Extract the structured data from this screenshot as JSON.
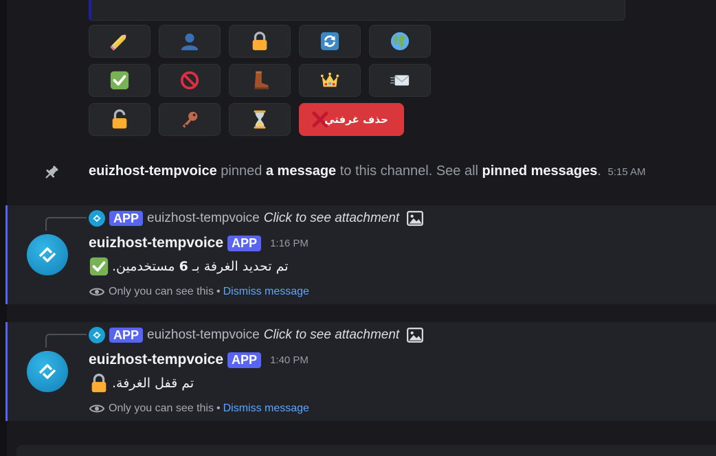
{
  "top_buttons": {
    "delete_room_label": "حذف غرفتي"
  },
  "icons": {
    "row1": [
      "pencil-icon",
      "user-icon",
      "lock-icon",
      "refresh-icon",
      "globe-icon"
    ],
    "row2": [
      "check-icon",
      "block-icon",
      "boot-icon",
      "crown-icon",
      "envelope-icon"
    ],
    "row3": [
      "unlock-icon",
      "key-icon",
      "hourglass-icon",
      "cross-icon"
    ]
  },
  "pin_notice": {
    "user": "euizhost-tempvoice",
    "pinned": " pinned ",
    "a_message": "a message",
    "to_channel": " to this channel. See all ",
    "pinned_messages": "pinned messages",
    "period": ".",
    "time": "5:15 AM"
  },
  "messages": [
    {
      "reply": {
        "badge": "APP",
        "name": "euizhost-tempvoice",
        "text": "Click to see attachment"
      },
      "author": "euizhost-tempvoice",
      "badge": "APP",
      "time": "1:16 PM",
      "text_before": "تم تحديد الغرفة بـ ",
      "text_bold": "6",
      "text_after": " مستخدمين.",
      "emoji": "check-icon",
      "only_you": "Only you can see this",
      "separator": "•",
      "dismiss": "Dismiss message"
    },
    {
      "reply": {
        "badge": "APP",
        "name": "euizhost-tempvoice",
        "text": "Click to see attachment"
      },
      "author": "euizhost-tempvoice",
      "badge": "APP",
      "time": "1:40 PM",
      "text": "تم قفل الغرفة.",
      "emoji": "lock-icon",
      "only_you": "Only you can see this",
      "separator": "•",
      "dismiss": "Dismiss message"
    }
  ],
  "colors": {
    "background": "#1a1a1e",
    "message_bg": "#222329",
    "accent": "#5865f2",
    "danger": "#da373c",
    "link": "#5ba7ff",
    "avatar": "#1c9fd4"
  }
}
